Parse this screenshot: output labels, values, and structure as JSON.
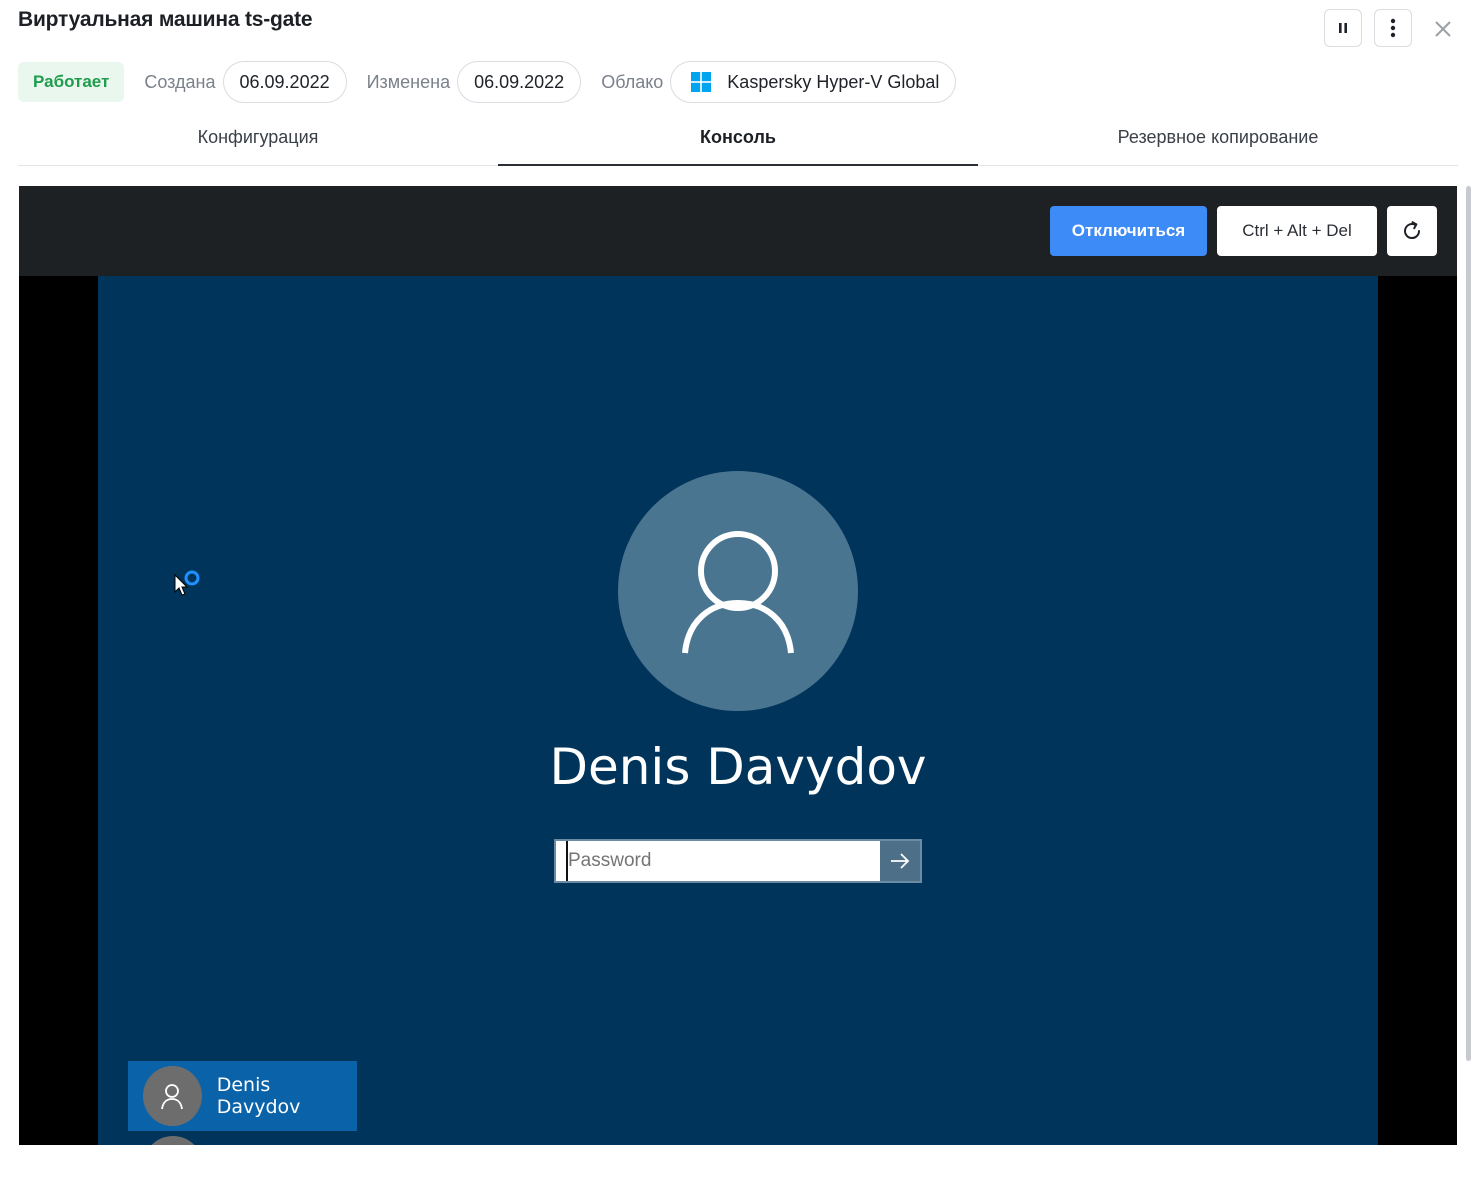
{
  "header": {
    "title": "Виртуальная машина ts-gate",
    "pause_icon": "pause-icon",
    "more_icon": "more-vertical-icon",
    "close_icon": "close-icon"
  },
  "meta": {
    "status": "Работает",
    "created_label": "Создана",
    "created_value": "06.09.2022",
    "modified_label": "Изменена",
    "modified_value": "06.09.2022",
    "cloud_label": "Облако",
    "cloud_value": "Kaspersky Hyper-V Global",
    "cloud_icon": "windows-icon"
  },
  "tabs": [
    {
      "label": "Конфигурация",
      "active": false
    },
    {
      "label": "Консоль",
      "active": true
    },
    {
      "label": "Резервное копирование",
      "active": false
    }
  ],
  "console": {
    "disconnect_label": "Отключиться",
    "cad_label": "Ctrl + Alt + Del",
    "refresh_icon": "refresh-icon",
    "login": {
      "user_name": "Denis Davydov",
      "password_placeholder": "Password",
      "submit_icon": "arrow-right-icon",
      "user_tile_name": "Denis Davydov"
    }
  },
  "colors": {
    "accent": "#3d8bf7",
    "status_bg": "#e9f7ee",
    "status_text": "#1f9d4c",
    "login_bg": "#00345a",
    "console_bar": "#1e2124"
  }
}
